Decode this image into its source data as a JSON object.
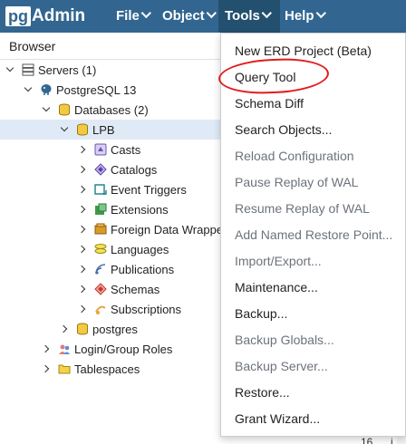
{
  "navbar": {
    "logo_box": "pg",
    "logo_rest": "Admin",
    "menus": [
      "File",
      "Object",
      "Tools",
      "Help"
    ]
  },
  "browser": {
    "title": "Browser"
  },
  "tree": [
    {
      "label": "Servers (1)",
      "icon": "servers-icon",
      "expanded": true
    },
    {
      "label": "PostgreSQL 13",
      "icon": "elephant-icon",
      "expanded": true
    },
    {
      "label": "Databases (2)",
      "icon": "databases-icon",
      "expanded": true
    },
    {
      "label": "LPB",
      "icon": "database-icon",
      "expanded": true,
      "selected": true
    },
    {
      "label": "Casts",
      "icon": "casts-icon",
      "expanded": false
    },
    {
      "label": "Catalogs",
      "icon": "catalogs-icon",
      "expanded": false
    },
    {
      "label": "Event Triggers",
      "icon": "event-triggers-icon",
      "expanded": false
    },
    {
      "label": "Extensions",
      "icon": "extensions-icon",
      "expanded": false
    },
    {
      "label": "Foreign Data Wrappe",
      "icon": "fdw-icon",
      "expanded": false
    },
    {
      "label": "Languages",
      "icon": "languages-icon",
      "expanded": false
    },
    {
      "label": "Publications",
      "icon": "publications-icon",
      "expanded": false
    },
    {
      "label": "Schemas",
      "icon": "schemas-icon",
      "expanded": false
    },
    {
      "label": "Subscriptions",
      "icon": "subscriptions-icon",
      "expanded": false
    },
    {
      "label": "postgres",
      "icon": "database-icon",
      "expanded": false
    },
    {
      "label": "Login/Group Roles",
      "icon": "roles-icon",
      "expanded": false
    },
    {
      "label": "Tablespaces",
      "icon": "tablespaces-icon",
      "expanded": false
    }
  ],
  "tools_menu": [
    {
      "label": "New ERD Project (Beta)",
      "enabled": true
    },
    {
      "label": "Query Tool",
      "enabled": true
    },
    {
      "label": "Schema Diff",
      "enabled": true
    },
    {
      "label": "Search Objects...",
      "enabled": true
    },
    {
      "label": "Reload Configuration",
      "enabled": false
    },
    {
      "label": "Pause Replay of WAL",
      "enabled": false
    },
    {
      "label": "Resume Replay of WAL",
      "enabled": false
    },
    {
      "label": "Add Named Restore Point...",
      "enabled": false
    },
    {
      "label": "Import/Export...",
      "enabled": false
    },
    {
      "label": "Maintenance...",
      "enabled": true
    },
    {
      "label": "Backup...",
      "enabled": true
    },
    {
      "label": "Backup Globals...",
      "enabled": false
    },
    {
      "label": "Backup Server...",
      "enabled": false
    },
    {
      "label": "Restore...",
      "enabled": true
    },
    {
      "label": "Grant Wizard...",
      "enabled": true
    }
  ],
  "footer": {
    "line_number": "16",
    "fragment": "i"
  },
  "colors": {
    "navbar": "#326690",
    "selected_row": "#dfeaf6",
    "annotation": "#e21c1c",
    "disabled_text": "#6c737b"
  }
}
